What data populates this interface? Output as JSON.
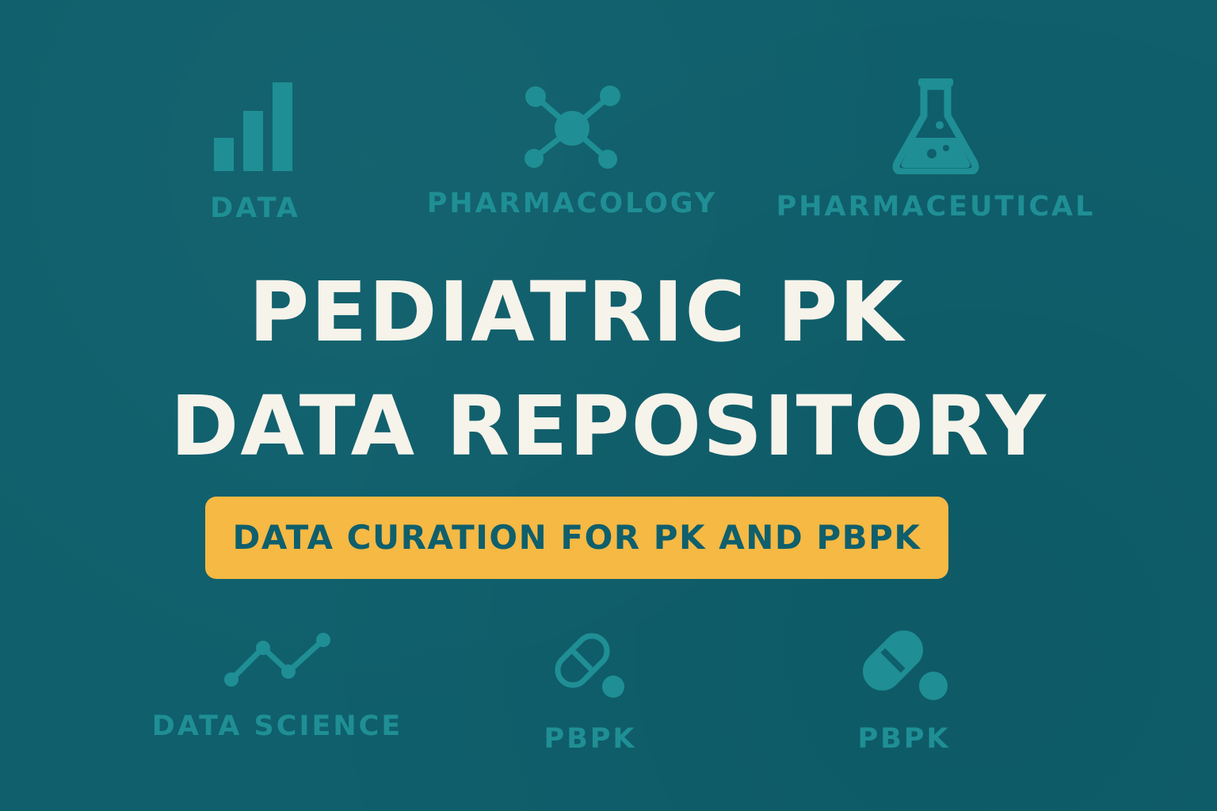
{
  "colors": {
    "background": "#0f5f6c",
    "icon_accent": "#1f8f95",
    "title_text": "#f6f3ea",
    "badge": "#f5b944",
    "badge_text": "#0f5f6c"
  },
  "top_icons": [
    {
      "icon": "bar-chart-icon",
      "label": "DATA"
    },
    {
      "icon": "molecule-icon",
      "label": "PHARMACOLOGY"
    },
    {
      "icon": "flask-icon",
      "label": "PHARMACEUTICAL"
    }
  ],
  "title": {
    "line1": "PEDIATRIC PK",
    "line2": "DATA REPOSITORY"
  },
  "subtitle": "DATA CURATION FOR PK AND PBPK",
  "bottom_icons": [
    {
      "icon": "line-chart-icon",
      "label": "DATA SCIENCE"
    },
    {
      "icon": "capsule-outline-icon",
      "label": "PBPK"
    },
    {
      "icon": "capsule-filled-icon",
      "label": "PBPK"
    }
  ]
}
